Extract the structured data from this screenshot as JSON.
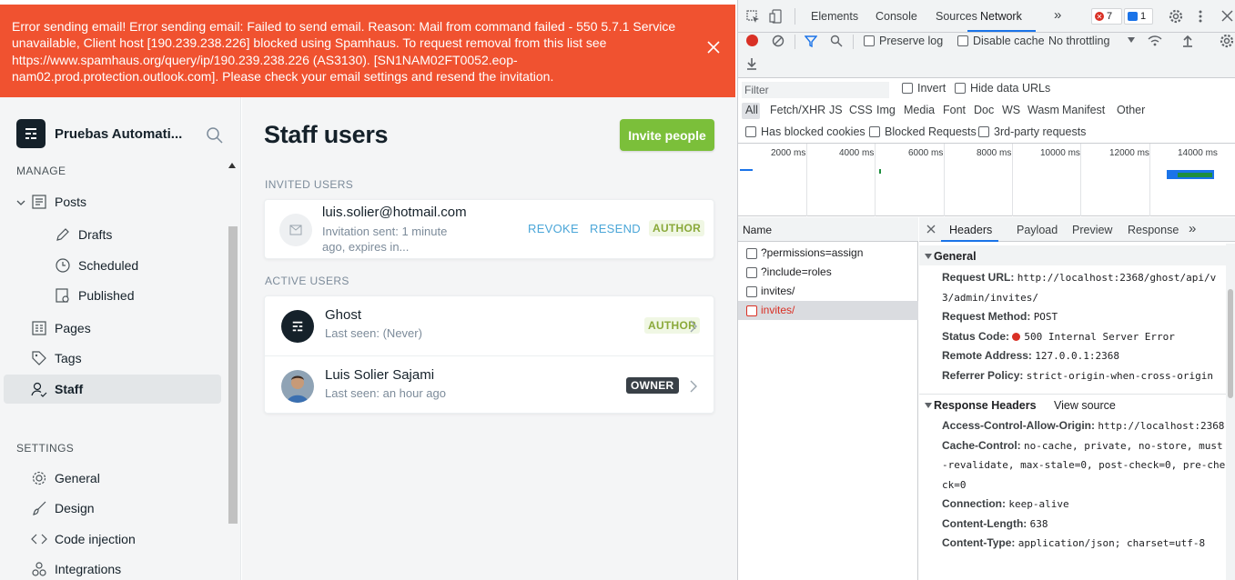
{
  "banner": {
    "message": "Error sending email! Error sending email: Failed to send email. Reason: Mail from command failed - 550 5.7.1 Service unavailable, Client host [190.239.238.226] blocked using Spamhaus. To request removal from this list see https://www.spamhaus.org/query/ip/190.239.238.226 (AS3130). [SN1NAM02FT0052.eop-nam02.prod.protection.outlook.com]. Please check your email settings and resend the invitation."
  },
  "sidebar": {
    "site_title": "Pruebas Automati...",
    "manage_heading": "MANAGE",
    "settings_heading": "SETTINGS",
    "manage_items": [
      {
        "label": "Posts"
      },
      {
        "label": "Drafts"
      },
      {
        "label": "Scheduled"
      },
      {
        "label": "Published"
      },
      {
        "label": "Pages"
      },
      {
        "label": "Tags"
      },
      {
        "label": "Staff"
      }
    ],
    "settings_items": [
      {
        "label": "General"
      },
      {
        "label": "Design"
      },
      {
        "label": "Code injection"
      },
      {
        "label": "Integrations"
      }
    ]
  },
  "main": {
    "title": "Staff users",
    "invite_button": "Invite people",
    "invited_heading": "INVITED USERS",
    "active_heading": "ACTIVE USERS",
    "invited": [
      {
        "email": "luis.solier@hotmail.com",
        "status": "Invitation sent: 1 minute ago, expires in...",
        "revoke": "REVOKE",
        "resend": "RESEND",
        "role": "AUTHOR"
      }
    ],
    "active": [
      {
        "name": "Ghost",
        "seen": "Last seen: (Never)",
        "role": "AUTHOR"
      },
      {
        "name": "Luis Solier Sajami",
        "seen": "Last seen: an hour ago",
        "role": "OWNER"
      }
    ]
  },
  "devtools": {
    "tabs": [
      "Elements",
      "Console",
      "Sources",
      "Network"
    ],
    "error_count": "7",
    "message_count": "1",
    "preserve_log": "Preserve log",
    "disable_cache": "Disable cache",
    "throttling": "No throttling",
    "filter_placeholder": "Filter",
    "invert": "Invert",
    "hide_data_urls": "Hide data URLs",
    "type_filters": [
      "All",
      "Fetch/XHR",
      "JS",
      "CSS",
      "Img",
      "Media",
      "Font",
      "Doc",
      "WS",
      "Wasm",
      "Manifest",
      "Other"
    ],
    "has_blocked_cookies": "Has blocked cookies",
    "blocked_requests": "Blocked Requests",
    "third_party": "3rd-party requests",
    "timeline_labels": [
      "2000 ms",
      "4000 ms",
      "6000 ms",
      "8000 ms",
      "10000 ms",
      "12000 ms",
      "14000 ms"
    ],
    "name_header": "Name",
    "requests": [
      "?permissions=assign",
      "?include=roles",
      "invites/",
      "invites/"
    ],
    "detail_tabs": [
      "Headers",
      "Payload",
      "Preview",
      "Response"
    ],
    "general_heading": "General",
    "general": [
      {
        "k": "Request URL:",
        "v": "http://localhost:2368/ghost/api/v3/admin/invites/"
      },
      {
        "k": "Request Method:",
        "v": "POST"
      },
      {
        "k": "Status Code:",
        "v": "500 Internal Server Error"
      },
      {
        "k": "Remote Address:",
        "v": "127.0.0.1:2368"
      },
      {
        "k": "Referrer Policy:",
        "v": "strict-origin-when-cross-origin"
      }
    ],
    "response_heading": "Response Headers",
    "view_source": "View source",
    "response": [
      {
        "k": "Access-Control-Allow-Origin:",
        "v": "http://localhost:2368"
      },
      {
        "k": "Cache-Control:",
        "v": "no-cache, private, no-store, must-revalidate, max-stale=0, post-check=0, pre-check=0"
      },
      {
        "k": "Connection:",
        "v": "keep-alive"
      },
      {
        "k": "Content-Length:",
        "v": "638"
      },
      {
        "k": "Content-Type:",
        "v": "application/json; charset=utf-8"
      }
    ]
  },
  "colors": {
    "banner": "#f05230",
    "invite_button": "#7bbf3a",
    "link_blue": "#4ba6d8",
    "error_red": "#d93025",
    "devtools_accent": "#1a73e8"
  }
}
